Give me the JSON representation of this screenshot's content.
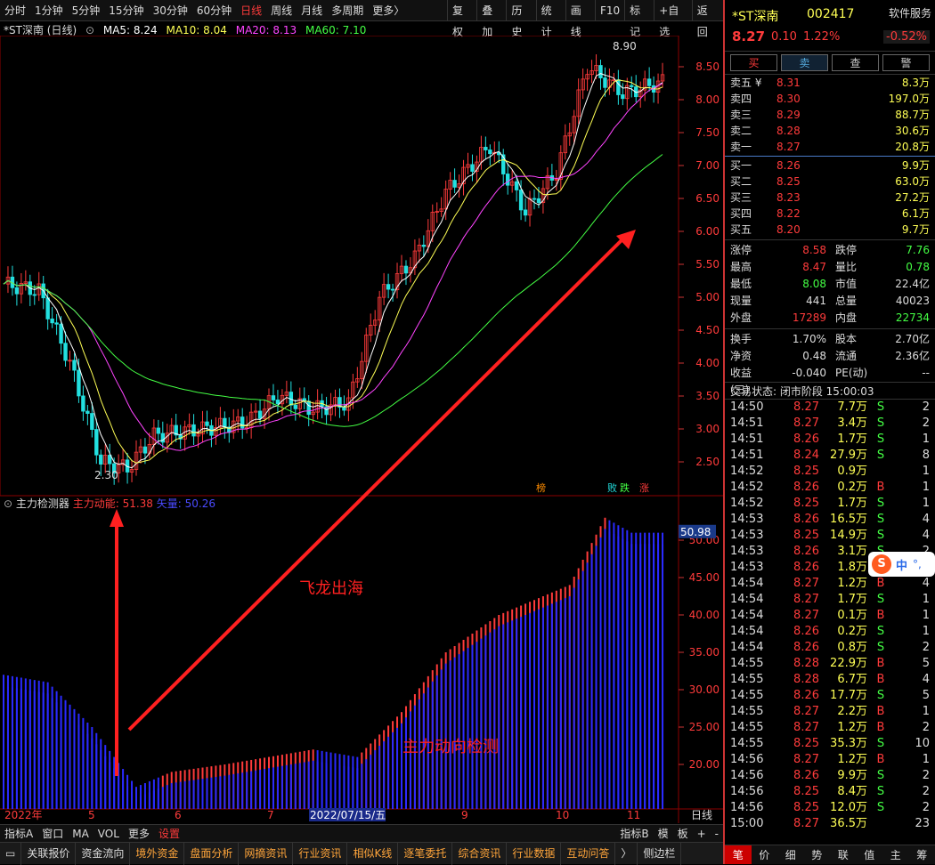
{
  "toolbar": {
    "tabs": [
      "分时",
      "1分钟",
      "5分钟",
      "15分钟",
      "30分钟",
      "60分钟",
      "日线",
      "周线",
      "月线",
      "多周期",
      "更多〉"
    ],
    "active": "日线",
    "right": [
      "复权",
      "叠加",
      "历史",
      "统计",
      "画线",
      "F10",
      "标记",
      "+自选",
      "返回"
    ]
  },
  "legend": {
    "title": "*ST深南 (日线)",
    "ma5": "MA5: 8.24",
    "ma10": "MA10: 8.04",
    "ma20": "MA20: 8.13",
    "ma60": "MA60: 7.10",
    "colors": {
      "ma5": "#ffffff",
      "ma10": "#ffff55",
      "ma20": "#ff44ff",
      "ma60": "#44ff44"
    }
  },
  "main_chart": {
    "y_ticks": [
      "8.50",
      "8.00",
      "7.50",
      "7.00",
      "6.50",
      "6.00",
      "5.50",
      "5.00",
      "4.50",
      "4.00",
      "3.50",
      "3.00",
      "2.50"
    ],
    "high_label": "8.90",
    "low_label": "2.30",
    "tags": [
      "榜",
      "败",
      "跌",
      "涨"
    ]
  },
  "indicator": {
    "name": "主力检测器",
    "field1": "主力动能: 51.38",
    "field2": "矢量: 50.26",
    "current": "50.98",
    "y_ticks": [
      "50.00",
      "45.00",
      "40.00",
      "35.00",
      "30.00",
      "25.00",
      "20.00"
    ],
    "annotation1": "飞龙出海",
    "annotation2": "主力动向检测"
  },
  "x_axis": {
    "labels": [
      "2022年",
      "5",
      "6",
      "7",
      "2022/07/15/五",
      "9",
      "10",
      "11"
    ],
    "period": "日线"
  },
  "bottombar": {
    "items": [
      "指标A",
      "窗口",
      "MA",
      "VOL",
      "更多",
      "设置"
    ],
    "right": [
      "指标B",
      "模",
      "板",
      "+",
      "-"
    ]
  },
  "navbar": {
    "items": [
      "关联报价",
      "资金流向",
      "境外资金",
      "盘面分析",
      "网摘资讯",
      "行业资讯",
      "相似K线",
      "逐笔委托",
      "综合资讯",
      "行业数据",
      "互动问答",
      "〉",
      "侧边栏"
    ]
  },
  "quote": {
    "name": "*ST深南",
    "code": "002417",
    "service": "软件服务",
    "price": "8.27",
    "change": "0.10",
    "pct": "1.22%",
    "pct2": "-0.52%",
    "buttons": [
      "买",
      "卖",
      "查",
      "警"
    ],
    "asks": [
      [
        "卖五 ¥",
        "8.31",
        "8.3万"
      ],
      [
        "卖四",
        "8.30",
        "197.0万"
      ],
      [
        "卖三",
        "8.29",
        "88.7万"
      ],
      [
        "卖二",
        "8.28",
        "30.6万"
      ],
      [
        "卖一",
        "8.27",
        "20.8万"
      ]
    ],
    "bids": [
      [
        "买一",
        "8.26",
        "9.9万"
      ],
      [
        "买二",
        "8.25",
        "63.0万"
      ],
      [
        "买三",
        "8.23",
        "27.2万"
      ],
      [
        "买四",
        "8.22",
        "6.1万"
      ],
      [
        "买五",
        "8.20",
        "9.7万"
      ]
    ],
    "stats": [
      [
        "涨停",
        "8.58",
        "跌停",
        "7.76"
      ],
      [
        "最高",
        "8.47",
        "量比",
        "0.78"
      ],
      [
        "最低",
        "8.08",
        "市值",
        "22.4亿"
      ],
      [
        "现量",
        "441",
        "总量",
        "40023"
      ],
      [
        "外盘",
        "17289",
        "内盘",
        "22734"
      ]
    ],
    "stats2": [
      [
        "换手",
        "1.70%",
        "股本",
        "2.70亿"
      ],
      [
        "净资",
        "0.48",
        "流通",
        "2.36亿"
      ],
      [
        "收益(三)",
        "-0.040",
        "PE(动)",
        "--"
      ]
    ],
    "status": "交易状态: 闭市阶段 15:00:03",
    "ticks": [
      [
        "14:50",
        "8.27",
        "7.7万",
        "S",
        "2"
      ],
      [
        "14:51",
        "8.27",
        "3.4万",
        "S",
        "2"
      ],
      [
        "14:51",
        "8.26",
        "1.7万",
        "S",
        "1"
      ],
      [
        "14:51",
        "8.24",
        "27.9万",
        "S",
        "8"
      ],
      [
        "14:52",
        "8.25",
        "0.9万",
        "",
        "1"
      ],
      [
        "14:52",
        "8.26",
        "0.2万",
        "B",
        "1"
      ],
      [
        "14:52",
        "8.25",
        "1.7万",
        "S",
        "1"
      ],
      [
        "14:53",
        "8.26",
        "16.5万",
        "S",
        "4"
      ],
      [
        "14:53",
        "8.25",
        "14.9万",
        "S",
        "4"
      ],
      [
        "14:53",
        "8.26",
        "3.1万",
        "S",
        "2"
      ],
      [
        "14:53",
        "8.26",
        "1.8万",
        "S",
        "1"
      ],
      [
        "14:54",
        "8.27",
        "1.2万",
        "B",
        "4"
      ],
      [
        "14:54",
        "8.27",
        "1.7万",
        "S",
        "1"
      ],
      [
        "14:54",
        "8.27",
        "0.1万",
        "B",
        "1"
      ],
      [
        "14:54",
        "8.26",
        "0.2万",
        "S",
        "1"
      ],
      [
        "14:54",
        "8.26",
        "0.8万",
        "S",
        "2"
      ],
      [
        "14:55",
        "8.28",
        "22.9万",
        "B",
        "5"
      ],
      [
        "14:55",
        "8.28",
        "6.7万",
        "B",
        "4"
      ],
      [
        "14:55",
        "8.26",
        "17.7万",
        "S",
        "5"
      ],
      [
        "14:55",
        "8.27",
        "2.2万",
        "B",
        "1"
      ],
      [
        "14:55",
        "8.27",
        "1.2万",
        "B",
        "2"
      ],
      [
        "14:55",
        "8.25",
        "35.3万",
        "S",
        "10"
      ],
      [
        "14:56",
        "8.27",
        "1.2万",
        "B",
        "1"
      ],
      [
        "14:56",
        "8.26",
        "9.9万",
        "S",
        "2"
      ],
      [
        "14:56",
        "8.25",
        "8.4万",
        "S",
        "2"
      ],
      [
        "14:56",
        "8.25",
        "12.0万",
        "S",
        "2"
      ],
      [
        "15:00",
        "8.27",
        "36.5万",
        "",
        "23"
      ]
    ],
    "tabs": [
      "笔",
      "价",
      "细",
      "势",
      "联",
      "值",
      "主",
      "筹"
    ]
  },
  "ime": {
    "label": "中"
  }
}
